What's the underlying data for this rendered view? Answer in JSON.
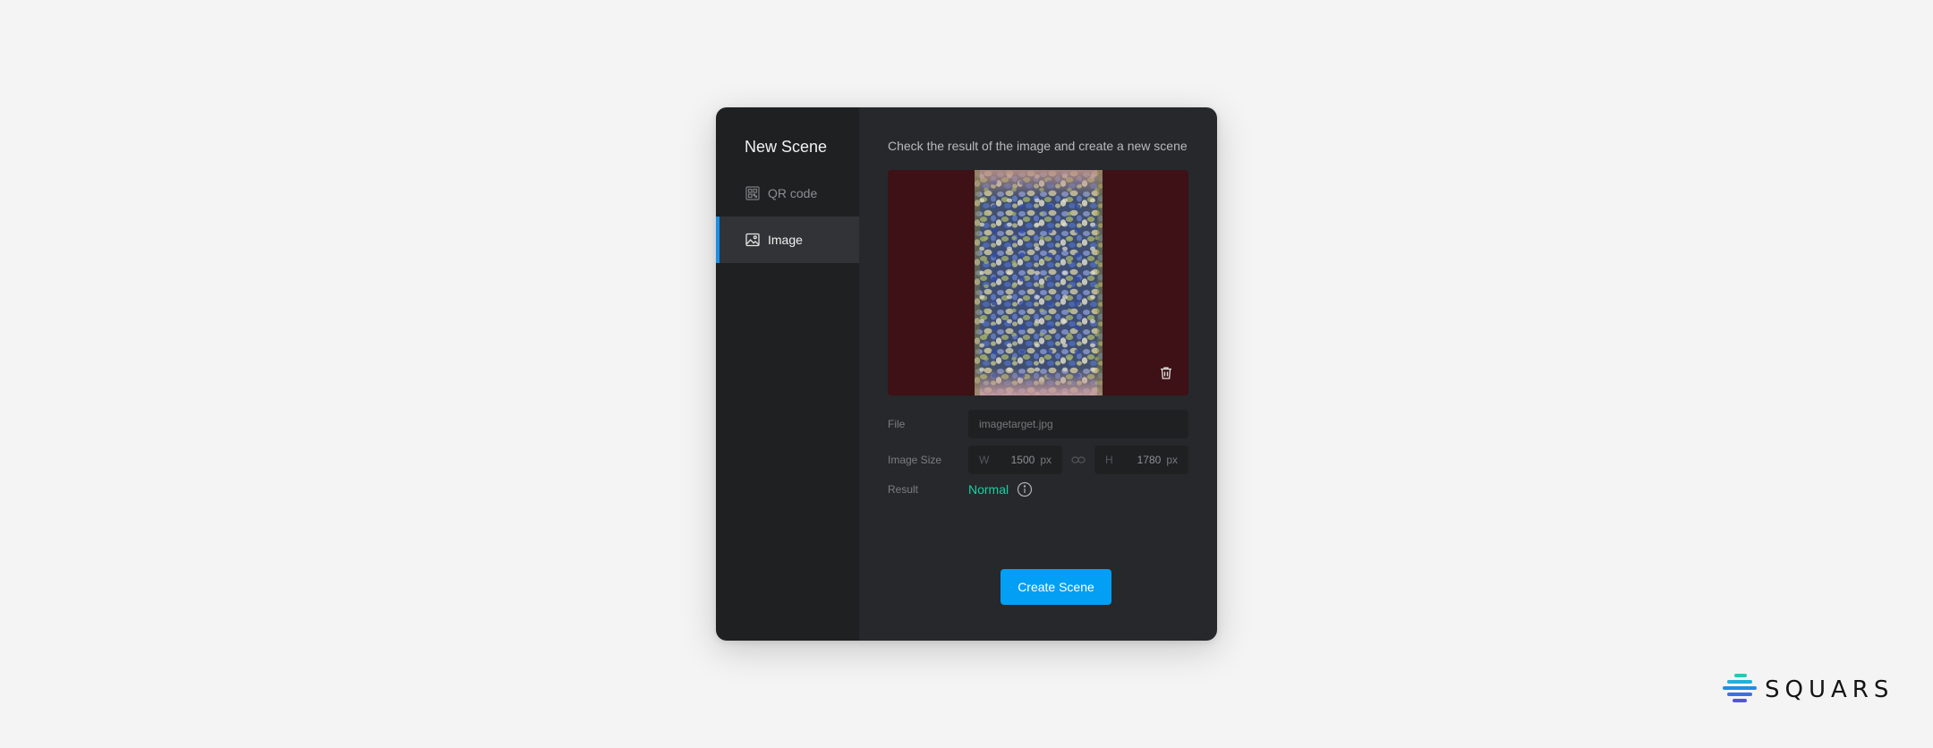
{
  "modal": {
    "title": "New Scene",
    "subtitle": "Check the result of the image and create a new scene"
  },
  "nav": {
    "items": [
      {
        "label": "QR code",
        "icon": "qr-code-icon",
        "active": false
      },
      {
        "label": "Image",
        "icon": "image-icon",
        "active": true
      }
    ]
  },
  "preview": {
    "background_color": "#3d1115",
    "delete_icon": "trash-icon"
  },
  "form": {
    "file_label": "File",
    "file_value": "imagetarget.jpg",
    "size_label": "Image Size",
    "width_axis": "W",
    "width_value": "1500",
    "width_unit": "px",
    "height_axis": "H",
    "height_value": "1780",
    "height_unit": "px",
    "link_icon": "link-icon",
    "result_label": "Result",
    "result_value": "Normal",
    "result_info_icon": "info-icon"
  },
  "actions": {
    "create_label": "Create Scene"
  },
  "brand": {
    "name": "SQUARS",
    "accent": "#029ff5",
    "status_color": "#17d1a4"
  }
}
